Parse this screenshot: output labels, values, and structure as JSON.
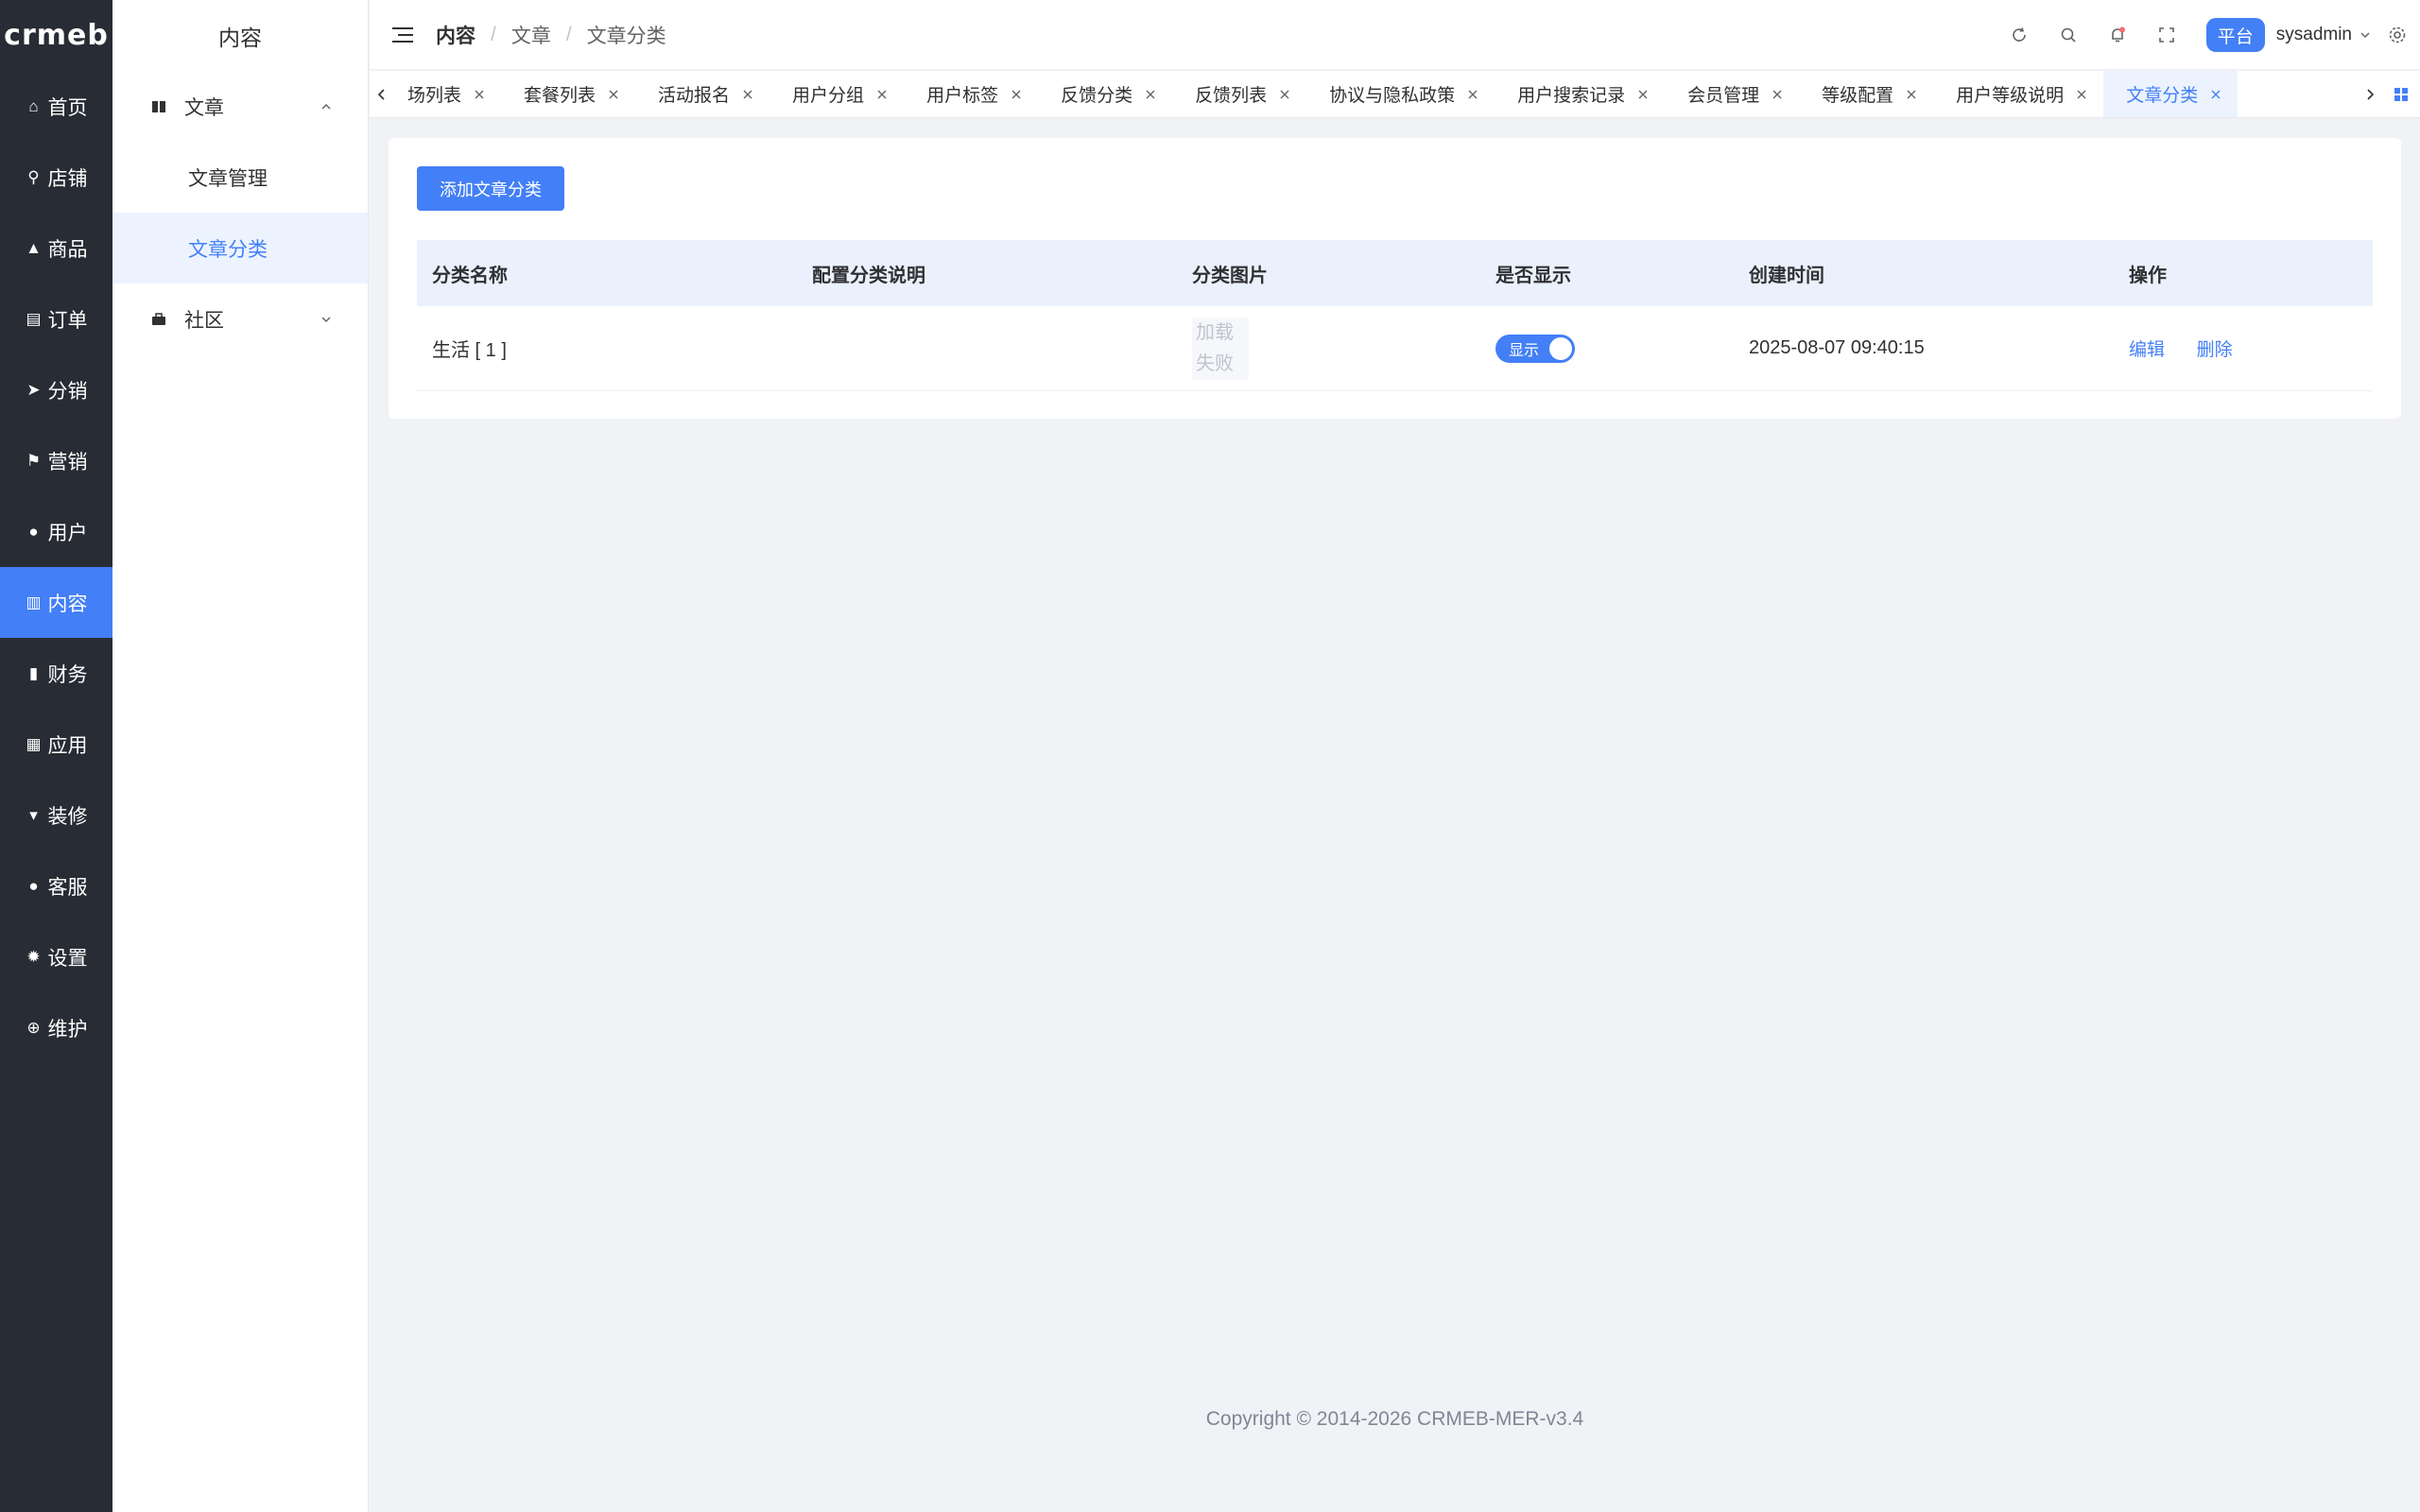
{
  "brand": {
    "logo_text": "crmeb"
  },
  "rail": {
    "items": [
      {
        "label": "首页",
        "icon": "home-icon",
        "glyph": "⌂"
      },
      {
        "label": "店铺",
        "icon": "store-icon",
        "glyph": "⚲"
      },
      {
        "label": "商品",
        "icon": "bag-icon",
        "glyph": "▲"
      },
      {
        "label": "订单",
        "icon": "order-icon",
        "glyph": "▤"
      },
      {
        "label": "分销",
        "icon": "send-icon",
        "glyph": "➤"
      },
      {
        "label": "营销",
        "icon": "flag-icon",
        "glyph": "⚑"
      },
      {
        "label": "用户",
        "icon": "user-icon",
        "glyph": "●"
      },
      {
        "label": "内容",
        "icon": "book-icon",
        "glyph": "▥"
      },
      {
        "label": "财务",
        "icon": "bar-chart-icon",
        "glyph": "▮"
      },
      {
        "label": "应用",
        "icon": "grid-icon",
        "glyph": "▦"
      },
      {
        "label": "装修",
        "icon": "brush-icon",
        "glyph": "▾"
      },
      {
        "label": "客服",
        "icon": "service-icon",
        "glyph": "●"
      },
      {
        "label": "设置",
        "icon": "gear-icon",
        "glyph": "✹"
      },
      {
        "label": "维护",
        "icon": "plus-circle-icon",
        "glyph": "⊕"
      }
    ],
    "active_index": 7
  },
  "submenu": {
    "title": "内容",
    "group_article": "文章",
    "child_manage": "文章管理",
    "child_category": "文章分类",
    "group_community": "社区"
  },
  "header": {
    "breadcrumb": [
      "内容",
      "文章",
      "文章分类"
    ],
    "separator": "/",
    "platform_label": "平台",
    "username": "sysadmin"
  },
  "tabs": [
    {
      "label": "场列表",
      "active": false
    },
    {
      "label": "套餐列表",
      "active": false
    },
    {
      "label": "活动报名",
      "active": false
    },
    {
      "label": "用户分组",
      "active": false
    },
    {
      "label": "用户标签",
      "active": false
    },
    {
      "label": "反馈分类",
      "active": false
    },
    {
      "label": "反馈列表",
      "active": false
    },
    {
      "label": "协议与隐私政策",
      "active": false
    },
    {
      "label": "用户搜索记录",
      "active": false
    },
    {
      "label": "会员管理",
      "active": false
    },
    {
      "label": "等级配置",
      "active": false
    },
    {
      "label": "用户等级说明",
      "active": false
    },
    {
      "label": "文章分类",
      "active": true
    }
  ],
  "toolbar": {
    "add_label": "添加文章分类"
  },
  "table": {
    "headers": [
      "分类名称",
      "配置分类说明",
      "分类图片",
      "是否显示",
      "创建时间",
      "操作"
    ],
    "rows": [
      {
        "name": "生活 [ 1 ]",
        "description": "",
        "image_fail_line1": "加载",
        "image_fail_line2": "失败",
        "switch_label": "显示",
        "switch_on": true,
        "created": "2025-08-07 09:40:15",
        "edit": "编辑",
        "delete": "删除"
      }
    ]
  },
  "footer": {
    "copyright": "Copyright © 2014-2026 CRMEB-MER-v3.4"
  },
  "colors": {
    "primary": "#437ff6",
    "rail_bg": "#282c34",
    "page_bg": "#f0f2f5"
  }
}
